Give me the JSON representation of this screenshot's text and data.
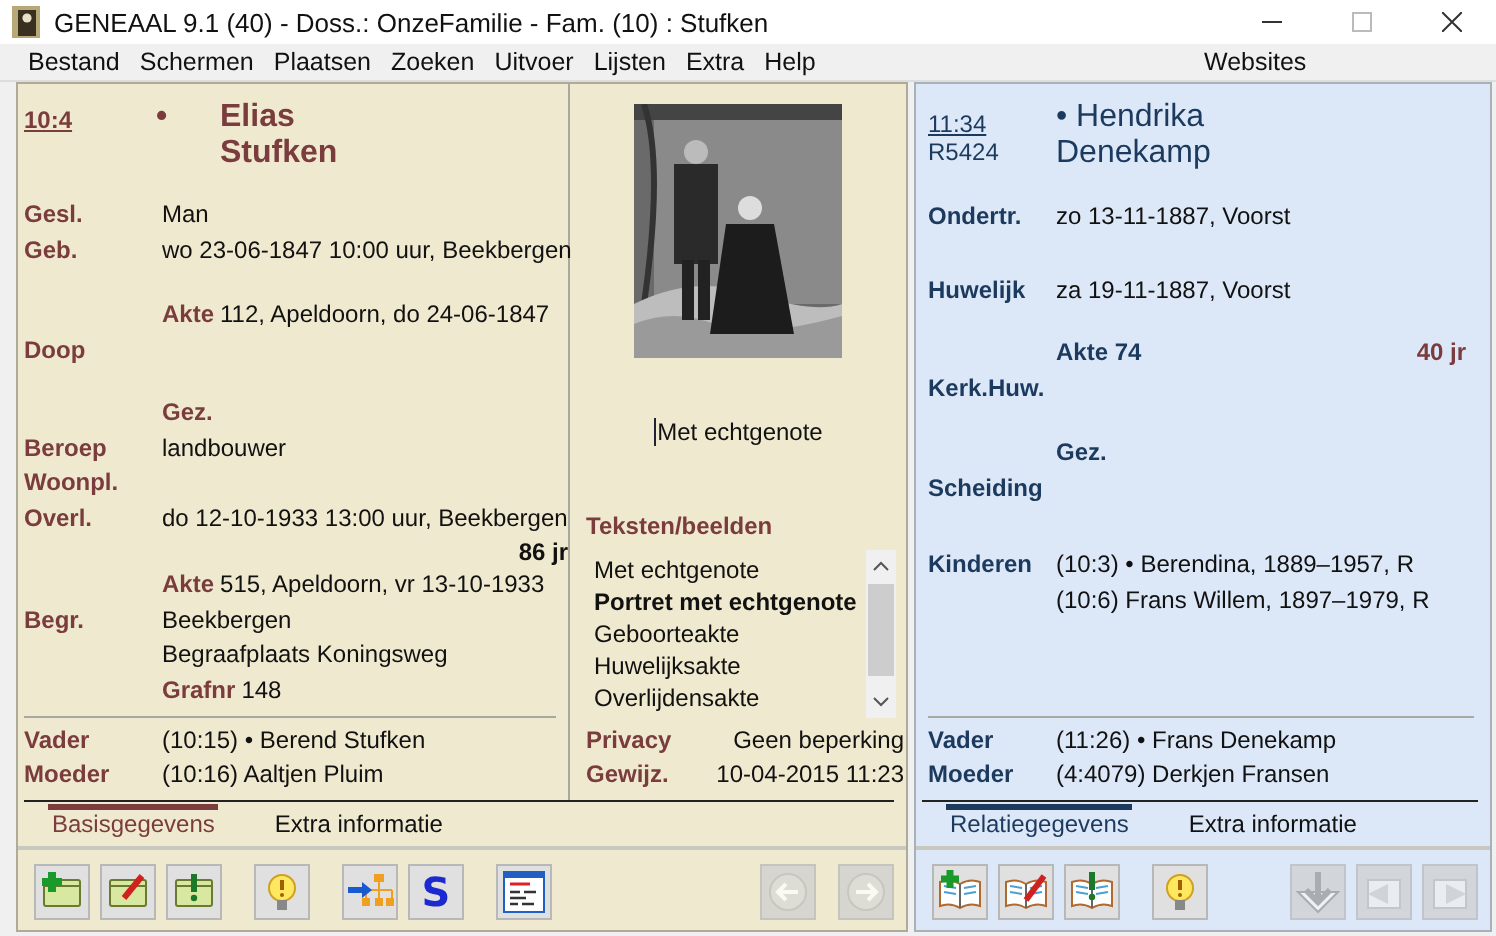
{
  "window": {
    "title": "GENEAAL 9.1 (40) - Doss.: OnzeFamilie - Fam. (10) : Stufken"
  },
  "menu": {
    "items": [
      "Bestand",
      "Schermen",
      "Plaatsen",
      "Zoeken",
      "Uitvoer",
      "Lijsten",
      "Extra",
      "Help"
    ],
    "right": "Websites"
  },
  "person": {
    "id": "10:4",
    "marker": "•",
    "given": "Elias",
    "surname": "Stufken",
    "rows": [
      {
        "kind": "field",
        "label": "Gesl.",
        "value": "Man"
      },
      {
        "kind": "field",
        "label": "Geb.",
        "value": "wo 23-06-1847 10:00 uur, Beekbergen"
      },
      {
        "kind": "sub",
        "label": "Akte",
        "value": "112, Apeldoorn, do 24-06-1847"
      },
      {
        "kind": "field",
        "label": "Doop"
      },
      {
        "kind": "sub",
        "label": "Gez."
      },
      {
        "kind": "field",
        "label": "Beroep",
        "value": "landbouwer"
      },
      {
        "kind": "field",
        "label": "Woonpl."
      },
      {
        "kind": "field",
        "label": "Overl.",
        "value": "do 12-10-1933 13:00 uur, Beekbergen"
      },
      {
        "kind": "age",
        "value": "86 jr"
      },
      {
        "kind": "sub",
        "label": "Akte",
        "value": "515, Apeldoorn, vr 13-10-1933"
      },
      {
        "kind": "field",
        "label": "Begr.",
        "value": "Beekbergen"
      },
      {
        "kind": "field",
        "value": "Begraafplaats Koningsweg"
      },
      {
        "kind": "sub",
        "label": "Grafnr",
        "value": "148"
      }
    ],
    "parents": [
      {
        "label": "Vader",
        "value": "(10:15) • Berend Stufken"
      },
      {
        "label": "Moeder",
        "value": "(10:16) Aaltjen Pluim"
      }
    ]
  },
  "media": {
    "caption": "Met echtgenote",
    "heading": "Teksten/beelden",
    "items": [
      {
        "label": "Met echtgenote",
        "selected": false
      },
      {
        "label": "Portret met echtgenote",
        "selected": true
      },
      {
        "label": "Geboorteakte",
        "selected": false
      },
      {
        "label": "Huwelijksakte",
        "selected": false
      },
      {
        "label": "Overlijdensakte",
        "selected": false
      }
    ],
    "meta": [
      {
        "label": "Privacy",
        "value": "Geen beperking"
      },
      {
        "label": "Gewijz.",
        "value": "10-04-2015 11:23"
      }
    ]
  },
  "left_tabs": [
    {
      "label": "Basisgegevens",
      "selected": true
    },
    {
      "label": "Extra informatie",
      "selected": false
    }
  ],
  "left_tools": [
    {
      "kind": "add",
      "disabled": false
    },
    {
      "kind": "edit",
      "disabled": false
    },
    {
      "kind": "alert",
      "disabled": false
    },
    {
      "kind": "hint",
      "disabled": false
    },
    {
      "kind": "tree",
      "disabled": false
    },
    {
      "kind": "letter",
      "label": "S",
      "disabled": false
    },
    {
      "kind": "report",
      "disabled": false
    },
    {
      "kind": "back",
      "disabled": true
    },
    {
      "kind": "forward",
      "disabled": true
    }
  ],
  "partner": {
    "id": "11:34",
    "ref": "R5424",
    "marker": "•",
    "given": "Hendrika",
    "surname": "Denekamp",
    "rows": [
      {
        "kind": "field",
        "label": "Ondertr.",
        "value": "zo 13-11-1887, Voorst"
      },
      {
        "kind": "field",
        "label": "Huwelijk",
        "value": "za 19-11-1887, Voorst"
      },
      {
        "kind": "akte",
        "label": "Akte 74",
        "age": "40 jr"
      },
      {
        "kind": "field",
        "label": "Kerk.Huw."
      },
      {
        "kind": "sub",
        "label": "Gez."
      },
      {
        "kind": "field",
        "label": "Scheiding"
      },
      {
        "kind": "field",
        "label": "Kinderen",
        "value": "(10:3) • Berendina, 1889–1957, R"
      },
      {
        "kind": "field",
        "value": "(10:6) Frans Willem, 1897–1979, R"
      }
    ],
    "parents": [
      {
        "label": "Vader",
        "value": "(11:26) • Frans Denekamp"
      },
      {
        "label": "Moeder",
        "value": "(4:4079) Derkjen Fransen"
      }
    ]
  },
  "right_tabs": [
    {
      "label": "Relatiegegevens",
      "selected": true
    },
    {
      "label": "Extra informatie",
      "selected": false
    }
  ],
  "right_tools": [
    {
      "kind": "book-add",
      "disabled": false
    },
    {
      "kind": "book-edit",
      "disabled": false
    },
    {
      "kind": "book-alert",
      "disabled": false
    },
    {
      "kind": "hint",
      "disabled": false
    },
    {
      "kind": "download",
      "disabled": true
    },
    {
      "kind": "book-back",
      "disabled": true
    },
    {
      "kind": "book-forward",
      "disabled": true
    }
  ]
}
